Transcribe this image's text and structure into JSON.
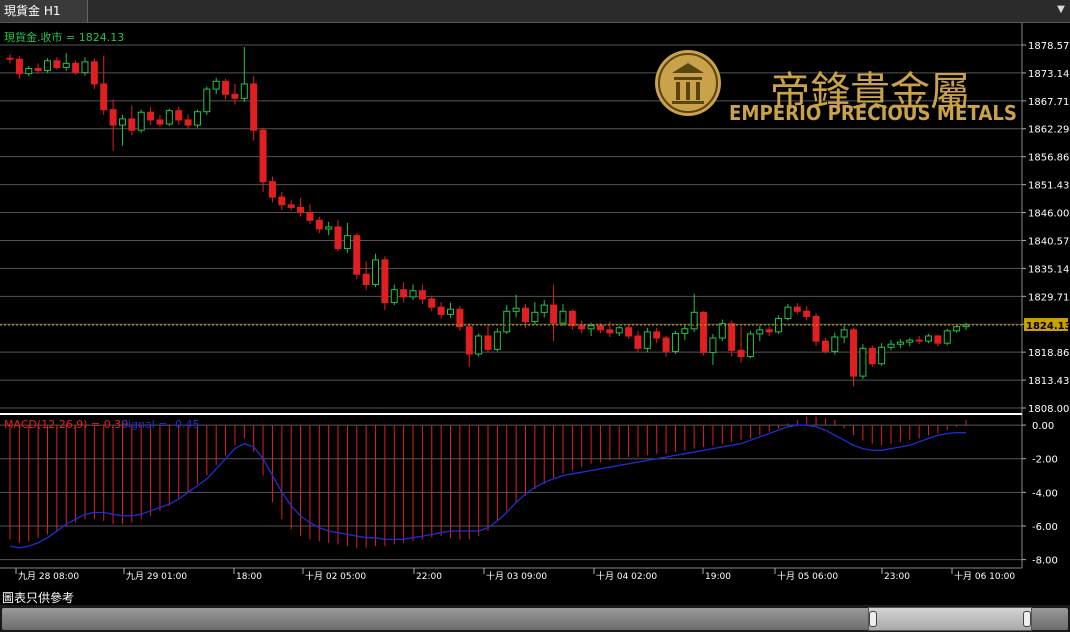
{
  "window": {
    "tab_label": "現貨金 H1"
  },
  "footer_note": "圖表只供參考",
  "logo": {
    "chinese": "帝鋒貴金屬",
    "english": "EMPERIO PRECIOUS METALS"
  },
  "colors": {
    "up": "#22c34a",
    "down": "#e02020",
    "price_line": "#c8a000",
    "signal": "#1e2fd0",
    "macd_bars": "#e02020",
    "axis_text": "#ffffff",
    "grid": "#555555",
    "logo_gold": "#c9a24a"
  },
  "chart_data": [
    {
      "type": "candlestick",
      "legend": "現貨金.收市 = 1824.13",
      "last_price_label": "1824.13",
      "last_price": 1824.13,
      "y_ticks": [
        "1878.57",
        "1873.14",
        "1867.71",
        "1862.29",
        "1856.86",
        "1851.43",
        "1846.00",
        "1840.57",
        "1835.14",
        "1829.71",
        "1824.29",
        "1818.86",
        "1813.43",
        "1808.00"
      ],
      "ylim": [
        1808.0,
        1878.57
      ],
      "x_tick_labels": [
        "九月 28 08:00",
        "九月 29 01:00",
        "18:00",
        "十月 02 05:00",
        "22:00",
        "十月 03 09:00",
        "十月 04 02:00",
        "19:00",
        "十月 05 06:00",
        "23:00",
        "十月 06 10:00"
      ],
      "ohlc": [
        [
          1876.0,
          1876.8,
          1875.0,
          1875.8
        ],
        [
          1875.8,
          1876.4,
          1872.0,
          1873.0
        ],
        [
          1873.0,
          1874.5,
          1872.5,
          1874.0
        ],
        [
          1874.0,
          1875.0,
          1873.0,
          1873.6
        ],
        [
          1873.6,
          1876.0,
          1873.2,
          1875.5
        ],
        [
          1875.5,
          1876.2,
          1873.8,
          1874.2
        ],
        [
          1874.2,
          1877.0,
          1873.5,
          1875.0
        ],
        [
          1875.0,
          1875.6,
          1872.8,
          1873.2
        ],
        [
          1873.2,
          1876.2,
          1872.6,
          1875.3
        ],
        [
          1875.3,
          1876.0,
          1870.0,
          1871.0
        ],
        [
          1871.0,
          1876.5,
          1865.0,
          1866.0
        ],
        [
          1866.0,
          1868.0,
          1858.0,
          1863.0
        ],
        [
          1863.0,
          1865.0,
          1859.0,
          1864.2
        ],
        [
          1864.2,
          1866.8,
          1861.0,
          1862.0
        ],
        [
          1862.0,
          1866.0,
          1861.5,
          1865.5
        ],
        [
          1865.5,
          1866.5,
          1863.0,
          1864.0
        ],
        [
          1864.0,
          1865.0,
          1862.6,
          1863.2
        ],
        [
          1863.2,
          1866.2,
          1862.8,
          1865.8
        ],
        [
          1865.8,
          1866.6,
          1863.0,
          1864.0
        ],
        [
          1864.0,
          1865.0,
          1862.2,
          1863.0
        ],
        [
          1863.0,
          1866.0,
          1862.5,
          1865.6
        ],
        [
          1865.6,
          1870.5,
          1865.0,
          1870.0
        ],
        [
          1870.0,
          1872.2,
          1869.0,
          1871.5
        ],
        [
          1871.5,
          1872.0,
          1868.0,
          1869.0
        ],
        [
          1869.0,
          1871.0,
          1867.0,
          1868.2
        ],
        [
          1868.2,
          1878.2,
          1867.5,
          1871.0
        ],
        [
          1871.0,
          1872.5,
          1860.0,
          1862.0
        ],
        [
          1862.0,
          1862.5,
          1850.0,
          1852.0
        ],
        [
          1852.0,
          1853.0,
          1848.0,
          1849.0
        ],
        [
          1849.0,
          1850.0,
          1846.5,
          1847.5
        ],
        [
          1847.5,
          1848.4,
          1846.4,
          1847.0
        ],
        [
          1847.0,
          1848.8,
          1845.2,
          1846.0
        ],
        [
          1846.0,
          1847.6,
          1843.8,
          1844.5
        ],
        [
          1844.5,
          1845.2,
          1842.0,
          1842.8
        ],
        [
          1842.8,
          1844.2,
          1841.6,
          1843.2
        ],
        [
          1843.2,
          1844.5,
          1838.5,
          1839.0
        ],
        [
          1839.0,
          1844.0,
          1838.2,
          1841.5
        ],
        [
          1841.5,
          1842.0,
          1833.0,
          1834.0
        ],
        [
          1834.0,
          1836.5,
          1831.0,
          1832.0
        ],
        [
          1832.0,
          1838.0,
          1831.5,
          1836.8
        ],
        [
          1836.8,
          1837.5,
          1827.0,
          1828.5
        ],
        [
          1828.5,
          1832.0,
          1828.0,
          1831.0
        ],
        [
          1831.0,
          1832.5,
          1828.5,
          1829.6
        ],
        [
          1829.6,
          1832.0,
          1829.0,
          1830.8
        ],
        [
          1830.8,
          1832.0,
          1828.2,
          1829.2
        ],
        [
          1829.2,
          1829.8,
          1826.8,
          1827.6
        ],
        [
          1827.6,
          1828.6,
          1825.4,
          1826.2
        ],
        [
          1826.2,
          1828.5,
          1825.5,
          1827.2
        ],
        [
          1827.2,
          1827.8,
          1823.0,
          1823.8
        ],
        [
          1823.8,
          1824.5,
          1816.0,
          1818.5
        ],
        [
          1818.5,
          1822.5,
          1818.0,
          1822.0
        ],
        [
          1822.0,
          1824.2,
          1818.8,
          1819.4
        ],
        [
          1819.4,
          1823.5,
          1819.0,
          1822.8
        ],
        [
          1822.8,
          1828.0,
          1822.4,
          1826.8
        ],
        [
          1826.8,
          1830.0,
          1825.6,
          1827.4
        ],
        [
          1827.4,
          1828.2,
          1823.6,
          1824.8
        ],
        [
          1824.8,
          1828.6,
          1824.2,
          1826.6
        ],
        [
          1826.6,
          1829.0,
          1825.6,
          1828.0
        ],
        [
          1828.0,
          1832.0,
          1821.0,
          1824.5
        ],
        [
          1824.5,
          1828.2,
          1824.0,
          1826.8
        ],
        [
          1826.8,
          1827.2,
          1823.2,
          1824.0
        ],
        [
          1824.0,
          1825.0,
          1822.5,
          1823.4
        ],
        [
          1823.4,
          1824.6,
          1822.0,
          1824.0
        ],
        [
          1824.0,
          1824.5,
          1822.6,
          1823.2
        ],
        [
          1823.2,
          1824.8,
          1821.8,
          1822.6
        ],
        [
          1822.6,
          1824.0,
          1822.0,
          1823.6
        ],
        [
          1823.6,
          1824.2,
          1821.4,
          1822.0
        ],
        [
          1822.0,
          1823.0,
          1818.8,
          1819.6
        ],
        [
          1819.6,
          1823.6,
          1818.8,
          1822.8
        ],
        [
          1822.8,
          1823.6,
          1820.6,
          1821.6
        ],
        [
          1821.6,
          1822.0,
          1818.0,
          1819.0
        ],
        [
          1819.0,
          1823.0,
          1818.5,
          1822.5
        ],
        [
          1822.5,
          1824.0,
          1821.2,
          1823.4
        ],
        [
          1823.4,
          1830.2,
          1822.8,
          1826.6
        ],
        [
          1826.6,
          1826.8,
          1818.2,
          1818.8
        ],
        [
          1818.8,
          1822.4,
          1816.4,
          1821.6
        ],
        [
          1821.6,
          1825.2,
          1821.0,
          1824.4
        ],
        [
          1824.4,
          1825.0,
          1818.0,
          1819.2
        ],
        [
          1819.2,
          1823.8,
          1816.8,
          1818.0
        ],
        [
          1818.0,
          1823.0,
          1817.6,
          1822.4
        ],
        [
          1822.4,
          1824.0,
          1821.0,
          1823.2
        ],
        [
          1823.2,
          1823.8,
          1822.0,
          1822.8
        ],
        [
          1822.8,
          1826.0,
          1822.4,
          1825.4
        ],
        [
          1825.4,
          1828.2,
          1825.0,
          1827.6
        ],
        [
          1827.6,
          1828.4,
          1826.2,
          1826.8
        ],
        [
          1826.8,
          1827.8,
          1825.0,
          1825.8
        ],
        [
          1825.8,
          1826.4,
          1820.0,
          1821.0
        ],
        [
          1821.0,
          1821.6,
          1818.6,
          1819.0
        ],
        [
          1819.0,
          1822.6,
          1818.4,
          1821.8
        ],
        [
          1821.8,
          1824.0,
          1820.6,
          1823.2
        ],
        [
          1823.2,
          1823.6,
          1812.2,
          1814.2
        ],
        [
          1814.2,
          1820.4,
          1813.6,
          1819.6
        ],
        [
          1819.6,
          1820.2,
          1816.0,
          1816.6
        ],
        [
          1816.6,
          1820.6,
          1816.2,
          1819.8
        ],
        [
          1819.8,
          1821.2,
          1819.2,
          1820.4
        ],
        [
          1820.4,
          1821.4,
          1819.6,
          1820.8
        ],
        [
          1820.8,
          1821.6,
          1820.0,
          1821.2
        ],
        [
          1821.2,
          1822.0,
          1820.4,
          1821.0
        ],
        [
          1821.0,
          1822.4,
          1820.6,
          1822.0
        ],
        [
          1822.0,
          1822.2,
          1820.0,
          1820.6
        ],
        [
          1820.6,
          1823.4,
          1820.2,
          1823.0
        ],
        [
          1823.0,
          1824.2,
          1822.6,
          1823.8
        ],
        [
          1823.8,
          1824.6,
          1823.2,
          1824.13
        ]
      ]
    },
    {
      "type": "bar",
      "name": "MACD",
      "legend_macd": "MACD(12,26,9) = 0.30",
      "legend_signal": "Signal = -0.45",
      "y_ticks": [
        "0.00",
        "-2.00",
        "-4.00",
        "-6.00",
        "-8.00"
      ],
      "ylim": [
        -8.5,
        0.6
      ],
      "macd": [
        -6.8,
        -7.0,
        -6.9,
        -6.7,
        -6.5,
        -6.3,
        -6.0,
        -5.8,
        -5.6,
        -5.6,
        -5.7,
        -5.9,
        -5.9,
        -5.8,
        -5.6,
        -5.4,
        -5.1,
        -4.8,
        -4.4,
        -4.0,
        -3.5,
        -3.0,
        -2.4,
        -1.8,
        -1.2,
        -0.8,
        -1.6,
        -3.0,
        -4.6,
        -5.6,
        -6.2,
        -6.6,
        -6.8,
        -6.9,
        -7.0,
        -7.1,
        -7.2,
        -7.3,
        -7.3,
        -7.2,
        -7.2,
        -7.1,
        -7.0,
        -6.9,
        -6.8,
        -6.7,
        -6.6,
        -6.7,
        -6.8,
        -6.8,
        -6.6,
        -6.3,
        -5.7,
        -5.1,
        -4.6,
        -4.2,
        -3.8,
        -3.5,
        -3.2,
        -2.9,
        -2.7,
        -2.5,
        -2.3,
        -2.2,
        -2.1,
        -2.0,
        -1.9,
        -1.9,
        -1.8,
        -1.7,
        -1.7,
        -1.6,
        -1.5,
        -1.4,
        -1.3,
        -1.2,
        -1.1,
        -1.0,
        -0.9,
        -0.8,
        -0.6,
        -0.4,
        -0.2,
        0.1,
        0.3,
        0.5,
        0.5,
        0.4,
        0.3,
        -0.2,
        -0.6,
        -0.9,
        -1.1,
        -1.2,
        -1.1,
        -1.0,
        -0.9,
        -0.8,
        -0.6,
        -0.5,
        -0.3,
        -0.1,
        0.3
      ],
      "signal": [
        -7.2,
        -7.3,
        -7.2,
        -7.0,
        -6.7,
        -6.3,
        -5.9,
        -5.6,
        -5.3,
        -5.2,
        -5.2,
        -5.3,
        -5.4,
        -5.4,
        -5.3,
        -5.1,
        -4.9,
        -4.7,
        -4.4,
        -4.0,
        -3.6,
        -3.2,
        -2.6,
        -2.0,
        -1.4,
        -1.1,
        -1.3,
        -2.0,
        -3.0,
        -4.0,
        -4.8,
        -5.4,
        -5.8,
        -6.1,
        -6.3,
        -6.4,
        -6.5,
        -6.6,
        -6.7,
        -6.7,
        -6.8,
        -6.8,
        -6.8,
        -6.7,
        -6.6,
        -6.5,
        -6.4,
        -6.3,
        -6.3,
        -6.3,
        -6.3,
        -6.1,
        -5.7,
        -5.2,
        -4.6,
        -4.1,
        -3.7,
        -3.4,
        -3.2,
        -3.0,
        -2.9,
        -2.8,
        -2.7,
        -2.6,
        -2.5,
        -2.4,
        -2.3,
        -2.2,
        -2.1,
        -2.0,
        -1.9,
        -1.8,
        -1.7,
        -1.6,
        -1.5,
        -1.4,
        -1.3,
        -1.2,
        -1.1,
        -0.9,
        -0.7,
        -0.5,
        -0.3,
        -0.1,
        0.0,
        0.0,
        -0.1,
        -0.3,
        -0.6,
        -0.9,
        -1.2,
        -1.4,
        -1.5,
        -1.5,
        -1.4,
        -1.3,
        -1.2,
        -1.0,
        -0.8,
        -0.6,
        -0.5,
        -0.45,
        -0.45
      ]
    }
  ]
}
